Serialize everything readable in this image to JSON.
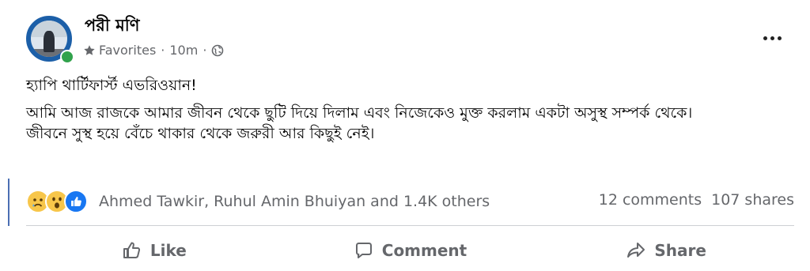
{
  "post": {
    "author": "পরী মণি",
    "audience": "Favorites",
    "time": "10m",
    "body": {
      "line1": "হ্যাপি থার্টিফার্স্ট এভরিওয়ান!",
      "line2": "আমি আজ রাজকে আমার জীবন থেকে ছুটি দিয়ে দিলাম এবং নিজেকেও মুক্ত করলাম একটা অসুস্থ সম্পর্ক থেকে।",
      "line3": "জীবনে সুস্থ হয়ে বেঁচে থাকার থেকে জরুরী আর কিছুই নেই।"
    }
  },
  "reactions": {
    "icons": [
      "sad-icon",
      "wow-icon",
      "like-icon"
    ],
    "names": "Ahmed Tawkir, Ruhul Amin Bhuiyan and 1.4K others",
    "comments": "12 comments",
    "shares": "107 shares"
  },
  "actions": {
    "like": "Like",
    "comment": "Comment",
    "share": "Share"
  },
  "colors": {
    "secondary_text": "#65676b",
    "like_blue": "#1877f2",
    "online_green": "#31a24c",
    "reaction_yellow": "#f7c64a"
  }
}
